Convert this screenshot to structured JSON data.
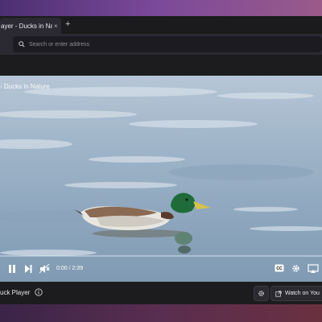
{
  "browser": {
    "tab": {
      "title": "ayer - Ducks in Nature",
      "close_glyph": "×"
    },
    "new_tab_glyph": "+",
    "search": {
      "placeholder": "Search or enter address"
    }
  },
  "player": {
    "video_title": "- Ducks in Nature",
    "current_time": "0:00",
    "duration": "2:39",
    "time_display": "0:00 / 2:39",
    "progress_fraction": 0.0
  },
  "bottombar": {
    "brand": "uck Player",
    "watch_label": "Watch on You"
  },
  "colors": {
    "browser_bg": "#1c1c1e",
    "water": "#9fb4c8",
    "duck_head": "#1f6b3a",
    "bill": "#d8c24a"
  },
  "icons": [
    "search-icon",
    "play-pause-icon",
    "next-icon",
    "mute-icon",
    "captions-icon",
    "settings-gear-icon",
    "airplay-icon",
    "info-icon",
    "gear-icon",
    "external-link-icon"
  ]
}
